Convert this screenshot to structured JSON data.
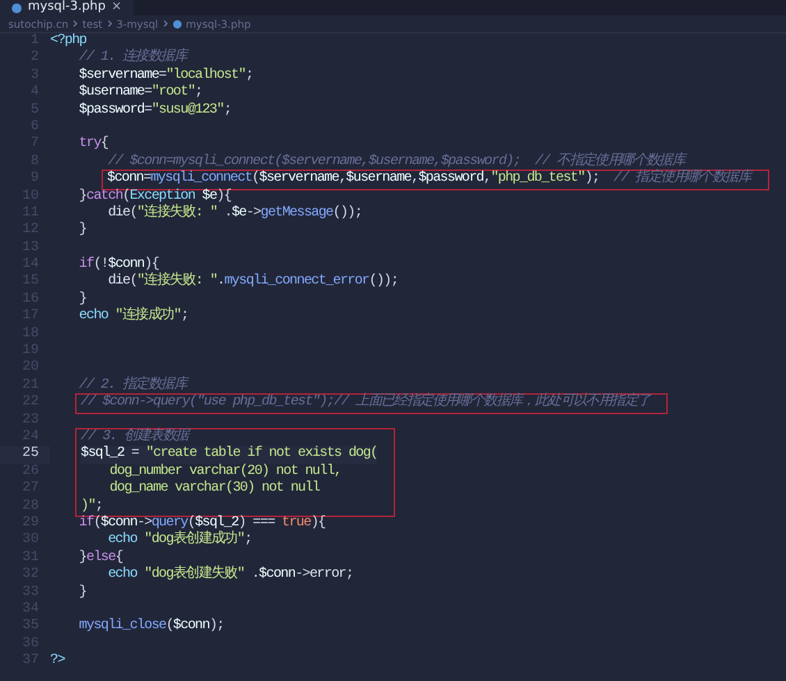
{
  "tabs": [
    {
      "label": "mysql-3.php",
      "selected": true,
      "close": "×"
    }
  ],
  "breadcrumb": [
    "sutochip.cn",
    "test",
    "3-mysql",
    "mysql-3.php"
  ],
  "blocks": [
    {
      "boxed": false,
      "lines": [
        {
          "number": "1",
          "current": false,
          "tokens": [
            {
              "kind": "tag",
              "text": "<?php"
            }
          ]
        },
        {
          "number": "2",
          "current": false,
          "tokens": [
            {
              "kind": "comment",
              "text": "    // 1. 连接数据库"
            }
          ]
        },
        {
          "number": "3",
          "current": false,
          "tokens": [
            {
              "kind": "var",
              "text": "    $servername"
            },
            {
              "kind": "punct",
              "text": "="
            },
            {
              "kind": "string",
              "text": "\"localhost\""
            },
            {
              "kind": "punct",
              "text": ";"
            }
          ]
        },
        {
          "number": "4",
          "current": false,
          "tokens": [
            {
              "kind": "var",
              "text": "    $username"
            },
            {
              "kind": "punct",
              "text": "="
            },
            {
              "kind": "string",
              "text": "\"root\""
            },
            {
              "kind": "punct",
              "text": ";"
            }
          ]
        },
        {
          "number": "5",
          "current": false,
          "tokens": [
            {
              "kind": "var",
              "text": "    $password"
            },
            {
              "kind": "punct",
              "text": "="
            },
            {
              "kind": "string",
              "text": "\"susu@123\""
            },
            {
              "kind": "punct",
              "text": ";"
            }
          ]
        },
        {
          "number": "6",
          "current": false
        },
        {
          "number": "7",
          "current": false,
          "tokens": [
            {
              "kind": "keyword",
              "text": "    try"
            },
            {
              "kind": "punct",
              "text": "{"
            }
          ]
        },
        {
          "number": "8",
          "current": false,
          "tokens": [
            {
              "kind": "comment",
              "text": "        // $conn=mysqli_connect($servername,$username,$password);  // 不指定使用哪个数据库"
            }
          ]
        }
      ]
    },
    {
      "boxed": true,
      "lines": [
        {
          "number": "9",
          "current": false,
          "tokens": [
            {
              "kind": "var",
              "text": "$conn"
            },
            {
              "kind": "punct",
              "text": "="
            },
            {
              "kind": "func",
              "text": "mysqli_connect"
            },
            {
              "kind": "punct",
              "text": "("
            },
            {
              "kind": "var",
              "text": "$servername"
            },
            {
              "kind": "punct",
              "text": ","
            },
            {
              "kind": "var",
              "text": "$username"
            },
            {
              "kind": "punct",
              "text": ","
            },
            {
              "kind": "var",
              "text": "$password"
            },
            {
              "kind": "punct",
              "text": ","
            },
            {
              "kind": "string",
              "text": "\"php_db_test\""
            },
            {
              "kind": "punct",
              "text": ");"
            },
            {
              "kind": "comment",
              "text": "  // 指定使用哪个数据库"
            }
          ]
        }
      ]
    },
    {
      "boxed": false,
      "lines": [
        {
          "number": "10",
          "current": false,
          "tokens": [
            {
              "kind": "punct",
              "text": "    }"
            },
            {
              "kind": "keyword",
              "text": "catch"
            },
            {
              "kind": "punct",
              "text": "("
            },
            {
              "kind": "type",
              "text": "Exception"
            },
            {
              "kind": "var",
              "text": " $e"
            },
            {
              "kind": "punct",
              "text": "){"
            }
          ]
        },
        {
          "number": "11",
          "current": false,
          "tokens": [
            {
              "kind": "plain",
              "text": "        die"
            },
            {
              "kind": "punct",
              "text": "("
            },
            {
              "kind": "string",
              "text": "\"连接失败: \""
            },
            {
              "kind": "punct",
              "text": " ."
            },
            {
              "kind": "var",
              "text": "$e"
            },
            {
              "kind": "punct",
              "text": "->"
            },
            {
              "kind": "func",
              "text": "getMessage"
            },
            {
              "kind": "punct",
              "text": "());"
            }
          ]
        },
        {
          "number": "12",
          "current": false,
          "tokens": [
            {
              "kind": "punct",
              "text": "    }"
            }
          ]
        },
        {
          "number": "13",
          "current": false
        },
        {
          "number": "14",
          "current": false,
          "tokens": [
            {
              "kind": "keyword",
              "text": "    if"
            },
            {
              "kind": "punct",
              "text": "(!"
            },
            {
              "kind": "var",
              "text": "$conn"
            },
            {
              "kind": "punct",
              "text": "){"
            }
          ]
        },
        {
          "number": "15",
          "current": false,
          "tokens": [
            {
              "kind": "plain",
              "text": "        die"
            },
            {
              "kind": "punct",
              "text": "("
            },
            {
              "kind": "string",
              "text": "\"连接失败: \""
            },
            {
              "kind": "punct",
              "text": "."
            },
            {
              "kind": "func",
              "text": "mysqli_connect_error"
            },
            {
              "kind": "punct",
              "text": "());"
            }
          ]
        },
        {
          "number": "16",
          "current": false,
          "tokens": [
            {
              "kind": "punct",
              "text": "    }"
            }
          ]
        },
        {
          "number": "17",
          "current": false,
          "tokens": [
            {
              "kind": "type",
              "text": "    echo"
            },
            {
              "kind": "string",
              "text": " \"连接成功\""
            },
            {
              "kind": "punct",
              "text": ";"
            }
          ]
        },
        {
          "number": "18",
          "current": false
        },
        {
          "number": "19",
          "current": false
        },
        {
          "number": "20",
          "current": false
        },
        {
          "number": "21",
          "current": false,
          "tokens": [
            {
              "kind": "comment",
              "text": "    // 2. 指定数据库"
            }
          ]
        }
      ]
    },
    {
      "boxed": true,
      "lines": [
        {
          "number": "22",
          "current": false,
          "tokens": [
            {
              "kind": "comment",
              "text": "// $conn->query(\"use php_db_test\");// 上面已经指定使用哪个数据库，此处可以不用指定了"
            }
          ]
        }
      ]
    },
    {
      "boxed": false,
      "lines": [
        {
          "number": "23",
          "current": false
        }
      ]
    },
    {
      "boxed": true,
      "lines": [
        {
          "number": "24",
          "current": false,
          "tokens": [
            {
              "kind": "comment",
              "text": "// 3. 创建表数据"
            }
          ]
        },
        {
          "number": "25",
          "current": true,
          "tokens": [
            {
              "kind": "var",
              "text": "$sql_2"
            },
            {
              "kind": "punct",
              "text": " = "
            },
            {
              "kind": "string",
              "text": "\"create table if not exists dog("
            }
          ]
        },
        {
          "number": "26",
          "current": false,
          "tokens": [
            {
              "kind": "string",
              "text": "    dog_number varchar(20) not null,"
            }
          ]
        },
        {
          "number": "27",
          "current": false,
          "tokens": [
            {
              "kind": "string",
              "text": "    dog_name varchar(30) not null"
            }
          ]
        },
        {
          "number": "28",
          "current": false,
          "tokens": [
            {
              "kind": "string",
              "text": ")\""
            },
            {
              "kind": "punct",
              "text": ";"
            }
          ]
        }
      ]
    },
    {
      "boxed": false,
      "lines": [
        {
          "number": "29",
          "current": false,
          "tokens": [
            {
              "kind": "keyword",
              "text": "    if"
            },
            {
              "kind": "punct",
              "text": "("
            },
            {
              "kind": "var",
              "text": "$conn"
            },
            {
              "kind": "punct",
              "text": "->"
            },
            {
              "kind": "func",
              "text": "query"
            },
            {
              "kind": "punct",
              "text": "("
            },
            {
              "kind": "var",
              "text": "$sql_2"
            },
            {
              "kind": "punct",
              "text": ") === "
            },
            {
              "kind": "const",
              "text": "true"
            },
            {
              "kind": "punct",
              "text": "){"
            }
          ]
        },
        {
          "number": "30",
          "current": false,
          "tokens": [
            {
              "kind": "type",
              "text": "        echo"
            },
            {
              "kind": "string",
              "text": " \"dog表创建成功\""
            },
            {
              "kind": "punct",
              "text": ";"
            }
          ]
        },
        {
          "number": "31",
          "current": false,
          "tokens": [
            {
              "kind": "punct",
              "text": "    }"
            },
            {
              "kind": "keyword",
              "text": "else"
            },
            {
              "kind": "punct",
              "text": "{"
            }
          ]
        },
        {
          "number": "32",
          "current": false,
          "tokens": [
            {
              "kind": "type",
              "text": "        echo"
            },
            {
              "kind": "string",
              "text": " \"dog表创建失败\""
            },
            {
              "kind": "punct",
              "text": " ."
            },
            {
              "kind": "var",
              "text": "$conn"
            },
            {
              "kind": "punct",
              "text": "->"
            },
            {
              "kind": "plain",
              "text": "error"
            },
            {
              "kind": "punct",
              "text": ";"
            }
          ]
        },
        {
          "number": "33",
          "current": false,
          "tokens": [
            {
              "kind": "punct",
              "text": "    }"
            }
          ]
        },
        {
          "number": "34",
          "current": false
        },
        {
          "number": "35",
          "current": false,
          "tokens": [
            {
              "kind": "func",
              "text": "    mysqli_close"
            },
            {
              "kind": "punct",
              "text": "("
            },
            {
              "kind": "var",
              "text": "$conn"
            },
            {
              "kind": "punct",
              "text": ");"
            }
          ]
        },
        {
          "number": "36",
          "current": false
        },
        {
          "number": "37",
          "current": false,
          "tokens": [
            {
              "kind": "tag",
              "text": "?>"
            }
          ]
        }
      ]
    }
  ]
}
